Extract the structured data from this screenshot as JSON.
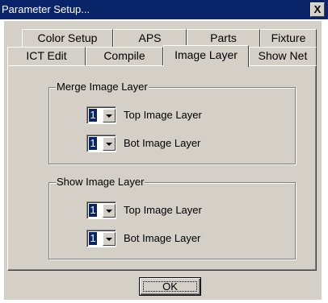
{
  "window": {
    "title": "Parameter Setup...",
    "close_label": "X"
  },
  "tabs": {
    "row1": [
      "Color Setup",
      "APS",
      "Parts",
      "Fixture"
    ],
    "row2": [
      "ICT Edit",
      "Compile",
      "Image Layer",
      "Show Net"
    ],
    "active": "Image Layer"
  },
  "merge_group": {
    "title": "Merge Image Layer",
    "top": {
      "value": "1",
      "label": "Top Image Layer"
    },
    "bot": {
      "value": "1",
      "label": "Bot Image Layer"
    }
  },
  "show_group": {
    "title": "Show Image Layer",
    "top": {
      "value": "1",
      "label": "Top Image Layer"
    },
    "bot": {
      "value": "1",
      "label": "Bot Image Layer"
    }
  },
  "ok_label": "OK"
}
